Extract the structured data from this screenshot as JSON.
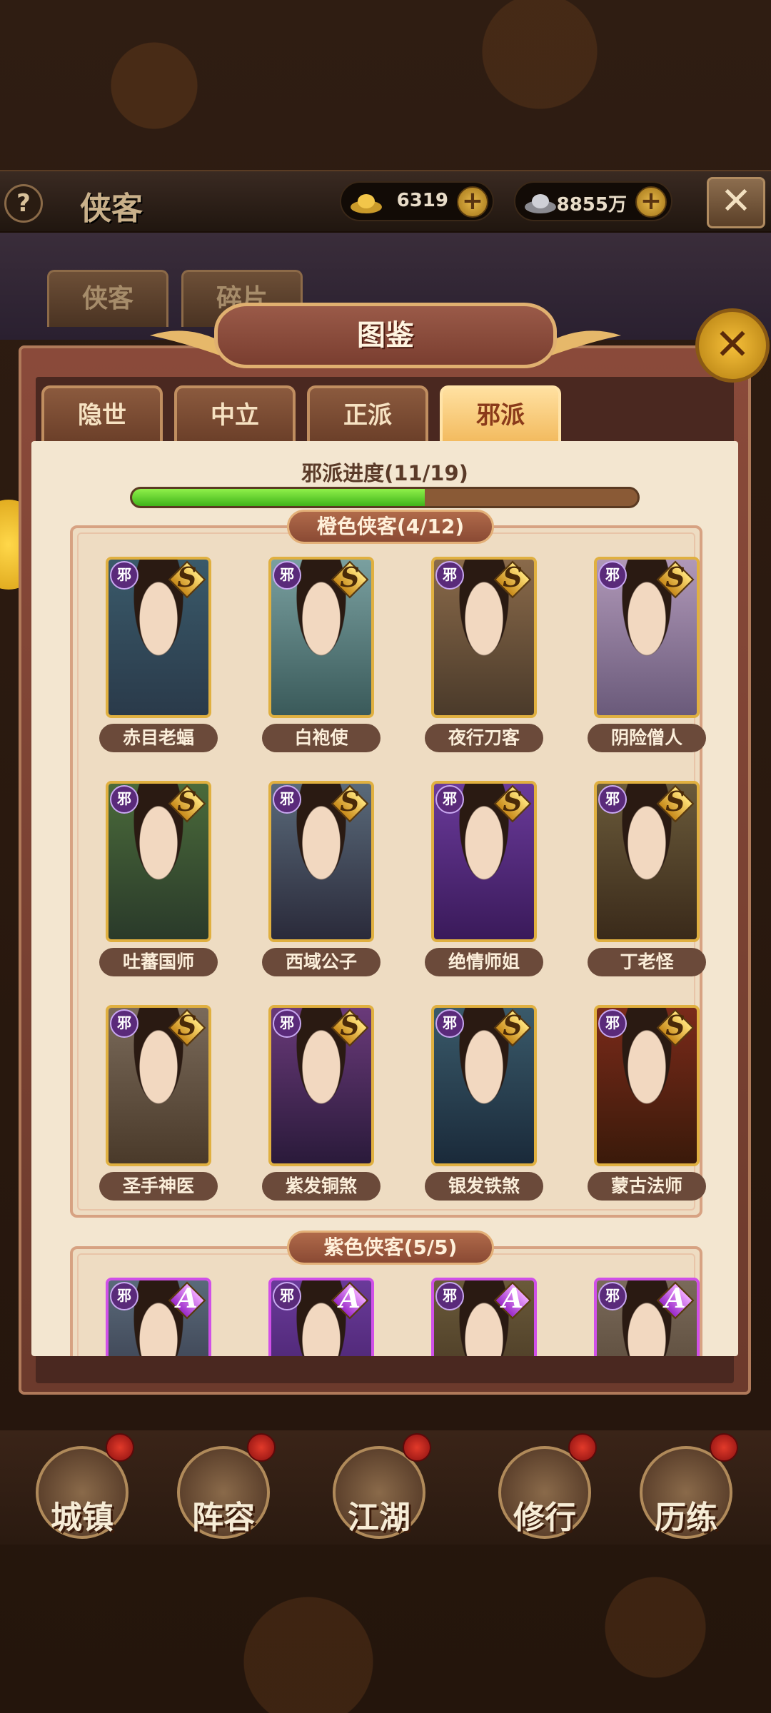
{
  "topbar": {
    "help_label": "?",
    "title": "侠客",
    "gold_value": "6319",
    "silver_value": "8855万",
    "plus_label": "+"
  },
  "back_tabs": [
    "侠客",
    "碎片"
  ],
  "dialog": {
    "title": "图鉴",
    "faction_tabs": [
      {
        "label": "隐世",
        "active": false
      },
      {
        "label": "中立",
        "active": false
      },
      {
        "label": "正派",
        "active": false
      },
      {
        "label": "邪派",
        "active": true
      }
    ],
    "progress": {
      "label": "邪派进度(11/19)",
      "current": 11,
      "total": 19
    },
    "sections": [
      {
        "title": "橙色侠客(4/12)",
        "faction_badge": "邪",
        "rank": "S",
        "heroes": [
          "赤目老蝠",
          "白袍使",
          "夜行刀客",
          "阴险僧人",
          "吐蕃国师",
          "西域公子",
          "绝情师姐",
          "丁老怪",
          "圣手神医",
          "紫发铜煞",
          "银发铁煞",
          "蒙古法师"
        ]
      },
      {
        "title": "紫色侠客(5/5)",
        "faction_badge": "邪",
        "rank": "A",
        "heroes": [
          "",
          "",
          "",
          ""
        ]
      }
    ]
  },
  "bottom_nav": [
    "城镇",
    "阵容",
    "江湖",
    "修行",
    "历练"
  ],
  "colors": {
    "orange_border": "#e0b040",
    "purple_border": "#d050e8",
    "progress_fill": "#3fb41a",
    "active_tab": "#f2b95c"
  }
}
